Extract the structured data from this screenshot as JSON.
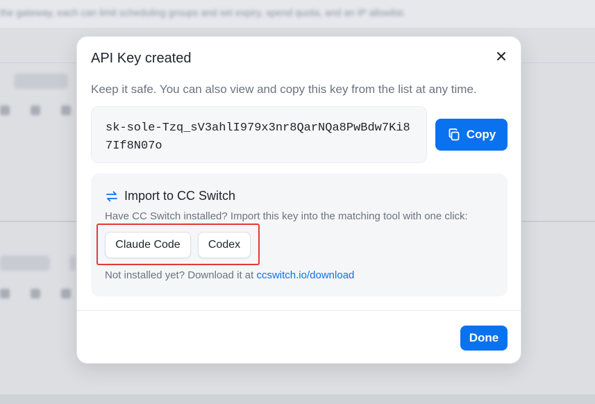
{
  "background": {
    "header_text": "the gateway, each can limit scheduling groups and set expiry, spend quota, and an IP allowlist."
  },
  "modal": {
    "title": "API Key created",
    "subtitle": "Keep it safe. You can also view and copy this key from the list at any time.",
    "api_key": "sk-sole-Tzq_sV3ahlI979x3nr8QarNQa8PwBdw7Ki87If8N07o",
    "copy_label": "Copy",
    "import": {
      "title": "Import to CC Switch",
      "description": "Have CC Switch installed? Import this key into the matching tool with one click:",
      "tools": [
        "Claude Code",
        "Codex"
      ],
      "download_prefix": "Not installed yet? Download it at",
      "download_link": "ccswitch.io/download"
    },
    "done_label": "Done"
  },
  "icons": {
    "close": "close-icon",
    "copy": "copy-icon",
    "switch": "switch-arrows-icon"
  },
  "colors": {
    "accent": "#0a72ef",
    "highlight": "#e53935"
  }
}
